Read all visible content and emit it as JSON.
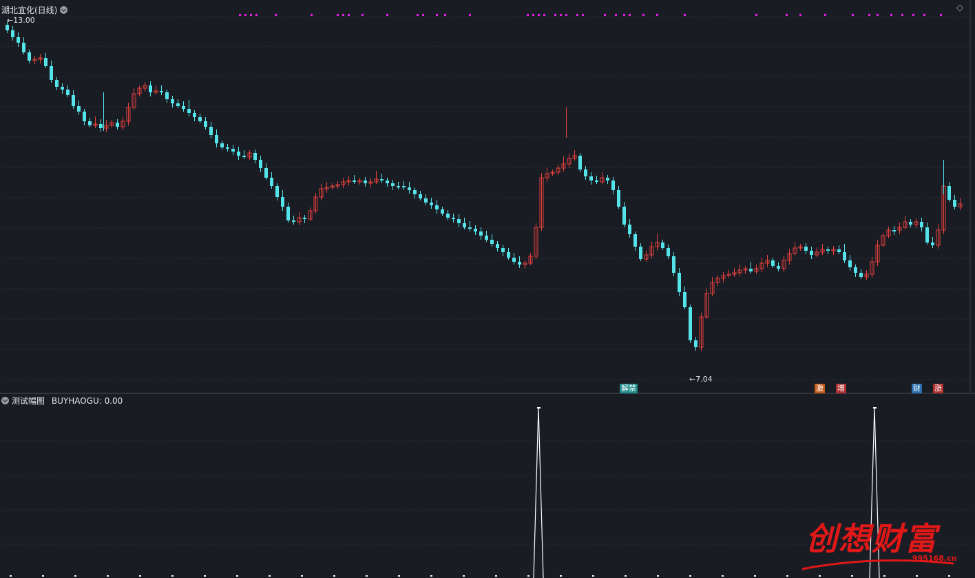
{
  "window": {
    "stock_title": "湖北宜化(日线)",
    "price_high_label": "13.00",
    "price_low_label": "7.04",
    "indicator_title": "测试幅图",
    "indicator_value": "BUYHAOGU: 0.00"
  },
  "event_tags": [
    {
      "text": "解禁",
      "color": "#1e8a8a"
    },
    {
      "text": "增",
      "color": "#b03030"
    },
    {
      "text": "激",
      "color": "#c05a1a"
    },
    {
      "text": "财",
      "color": "#2a6fb0"
    },
    {
      "text": "涨",
      "color": "#b03030"
    }
  ],
  "watermark": {
    "brand": "创想财富",
    "site": "995168.cn"
  },
  "colors": {
    "background": "#1a1c24",
    "up": "#e8413c",
    "down": "#54e3e8",
    "grid": "#3a3e48",
    "marker": "#e020e0",
    "signal_line": "#ffffff"
  },
  "icons": {
    "collapse": "chevron-down-icon",
    "settings": "diamond-icon"
  },
  "chart_data": {
    "type": "candlestick",
    "ylim": [
      7.04,
      13.0
    ],
    "high": 13.0,
    "low": 7.04,
    "signal_series": {
      "name": "BUYHAOGU",
      "baseline": 0,
      "peaks": [
        1,
        1
      ],
      "current": 0.0
    }
  }
}
